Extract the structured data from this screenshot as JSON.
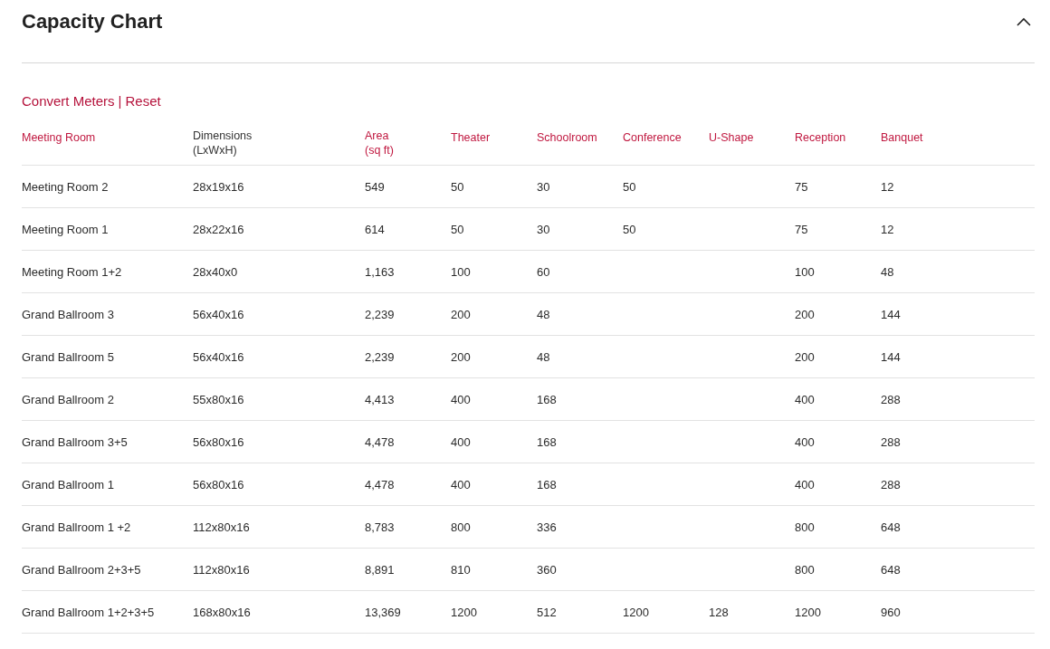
{
  "section": {
    "title": "Capacity Chart",
    "expanded": true
  },
  "unit_links": {
    "convert": "Convert Meters",
    "separator": "|",
    "reset": "Reset"
  },
  "table": {
    "columns": [
      {
        "label": "Meeting Room",
        "sortable": true
      },
      {
        "label": "Dimensions",
        "sublabel": "(LxWxH)",
        "sortable": false
      },
      {
        "label": "Area",
        "sublabel": "(sq ft)",
        "sortable": true
      },
      {
        "label": "Theater",
        "sortable": true
      },
      {
        "label": "Schoolroom",
        "sortable": true
      },
      {
        "label": "Conference",
        "sortable": true
      },
      {
        "label": "U-Shape",
        "sortable": true
      },
      {
        "label": "Reception",
        "sortable": true
      },
      {
        "label": "Banquet",
        "sortable": true
      }
    ],
    "rows": [
      [
        "Meeting Room 2",
        "28x19x16",
        "549",
        "50",
        "30",
        "50",
        null,
        "75",
        "12"
      ],
      [
        "Meeting Room 1",
        "28x22x16",
        "614",
        "50",
        "30",
        "50",
        null,
        "75",
        "12"
      ],
      [
        "Meeting Room 1+2",
        "28x40x0",
        "1,163",
        "100",
        "60",
        null,
        null,
        "100",
        "48"
      ],
      [
        "Grand Ballroom 3",
        "56x40x16",
        "2,239",
        "200",
        "48",
        null,
        null,
        "200",
        "144"
      ],
      [
        "Grand Ballroom 5",
        "56x40x16",
        "2,239",
        "200",
        "48",
        null,
        null,
        "200",
        "144"
      ],
      [
        "Grand Ballroom 2",
        "55x80x16",
        "4,413",
        "400",
        "168",
        null,
        null,
        "400",
        "288"
      ],
      [
        "Grand Ballroom 3+5",
        "56x80x16",
        "4,478",
        "400",
        "168",
        null,
        null,
        "400",
        "288"
      ],
      [
        "Grand Ballroom 1",
        "56x80x16",
        "4,478",
        "400",
        "168",
        null,
        null,
        "400",
        "288"
      ],
      [
        "Grand Ballroom 1 +2",
        "112x80x16",
        "8,783",
        "800",
        "336",
        null,
        null,
        "800",
        "648"
      ],
      [
        "Grand Ballroom 2+3+5",
        "112x80x16",
        "8,891",
        "810",
        "360",
        null,
        null,
        "800",
        "648"
      ],
      [
        "Grand Ballroom 1+2+3+5",
        "168x80x16",
        "13,369",
        "1200",
        "512",
        "1200",
        "128",
        "1200",
        "960"
      ]
    ]
  }
}
